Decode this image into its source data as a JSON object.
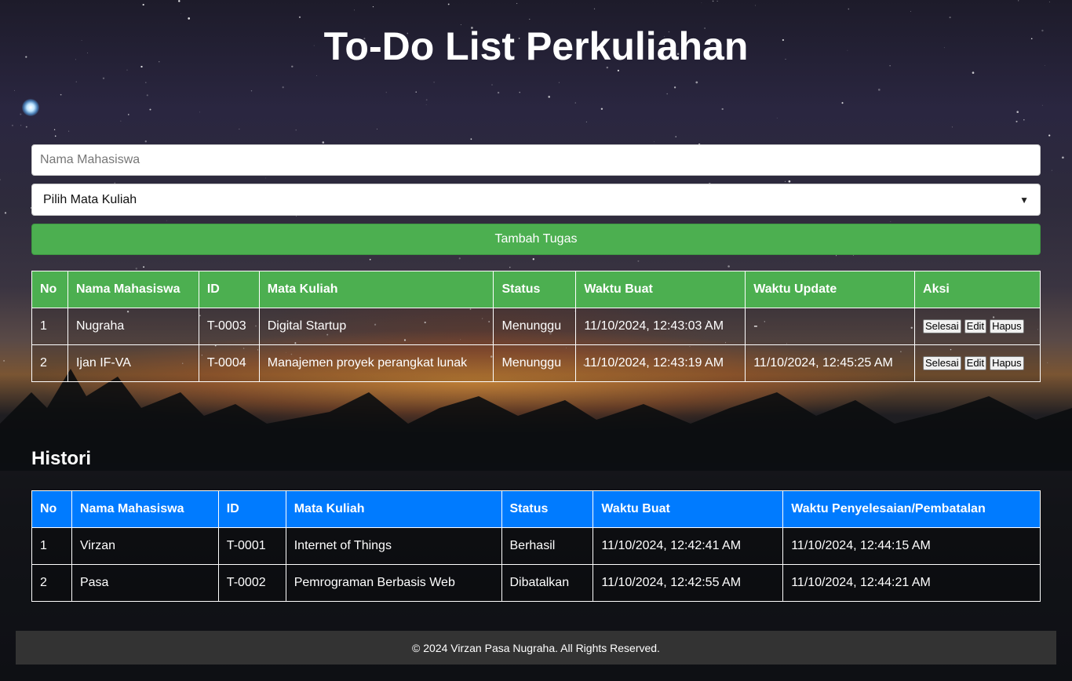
{
  "page": {
    "title": "To-Do List Perkuliahan"
  },
  "form": {
    "name_placeholder": "Nama Mahasiswa",
    "name_value": "",
    "course_select_value": "Pilih Mata Kuliah",
    "add_button_label": "Tambah Tugas"
  },
  "tasks": {
    "headers": [
      "No",
      "Nama Mahasiswa",
      "ID",
      "Mata Kuliah",
      "Status",
      "Waktu Buat",
      "Waktu Update",
      "Aksi"
    ],
    "rows": [
      {
        "no": "1",
        "name": "Nugraha",
        "id": "T-0003",
        "course": "Digital Startup",
        "status": "Menunggu",
        "created": "11/10/2024, 12:43:03 AM",
        "updated": "-"
      },
      {
        "no": "2",
        "name": "Ijan IF-VA",
        "id": "T-0004",
        "course": "Manajemen proyek perangkat lunak",
        "status": "Menunggu",
        "created": "11/10/2024, 12:43:19 AM",
        "updated": "11/10/2024, 12:45:25 AM"
      }
    ],
    "actions": {
      "done": "Selesai",
      "edit": "Edit",
      "delete": "Hapus"
    }
  },
  "history": {
    "title": "Histori",
    "headers": [
      "No",
      "Nama Mahasiswa",
      "ID",
      "Mata Kuliah",
      "Status",
      "Waktu Buat",
      "Waktu Penyelesaian/Pembatalan"
    ],
    "rows": [
      {
        "no": "1",
        "name": "Virzan",
        "id": "T-0001",
        "course": "Internet of Things",
        "status": "Berhasil",
        "created": "11/10/2024, 12:42:41 AM",
        "finished": "11/10/2024, 12:44:15 AM"
      },
      {
        "no": "2",
        "name": "Pasa",
        "id": "T-0002",
        "course": "Pemrograman Berbasis Web",
        "status": "Dibatalkan",
        "created": "11/10/2024, 12:42:55 AM",
        "finished": "11/10/2024, 12:44:21 AM"
      }
    ]
  },
  "footer": {
    "text": "© 2024 Virzan Pasa Nugraha. All Rights Reserved."
  },
  "colors": {
    "task_header": "#4caf50",
    "history_header": "#007bff",
    "footer_bg": "#333333"
  }
}
